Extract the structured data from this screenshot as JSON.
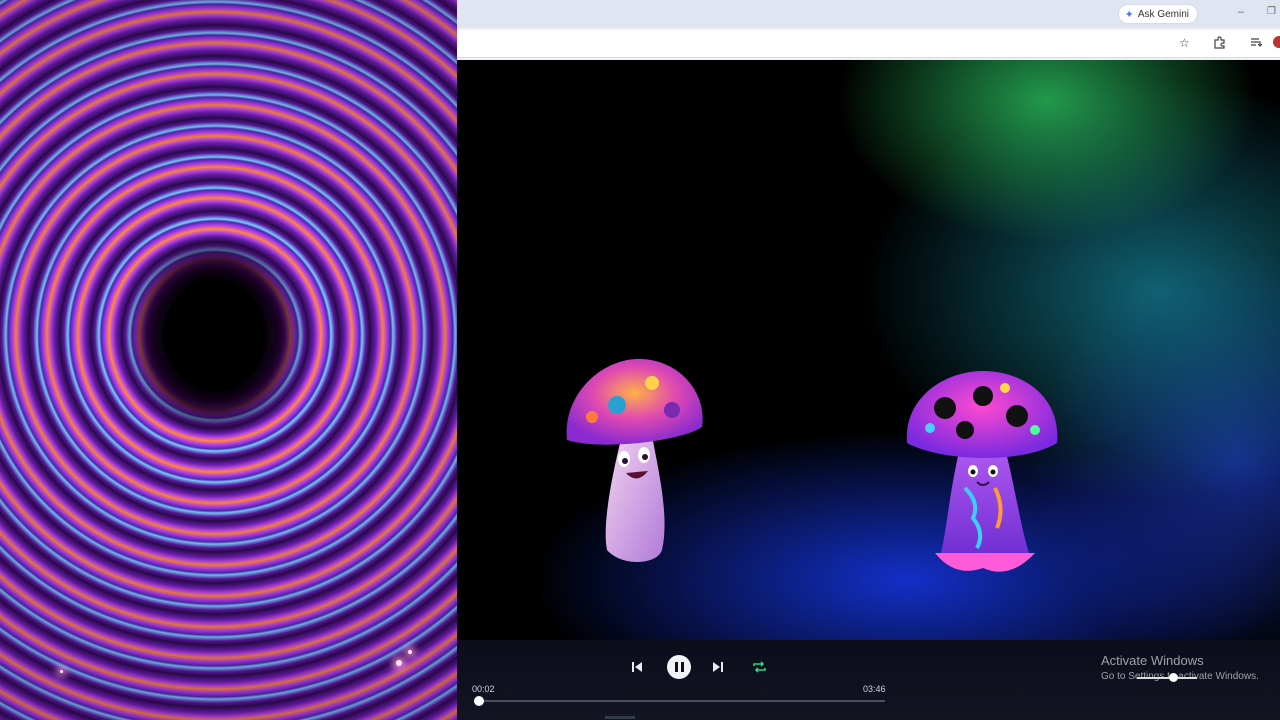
{
  "browser": {
    "gemini_label": "Ask Gemini"
  },
  "player": {
    "current_time": "00:02",
    "duration": "03:46",
    "progress": 0.009,
    "volume": 0.55,
    "state": "playing"
  },
  "watermark": {
    "line1": "Activate Windows",
    "line2": "Go to Settings to activate Windows."
  },
  "icons": {
    "previous": "skip-previous-icon",
    "pause": "pause-icon",
    "next": "skip-next-icon",
    "repeat": "repeat-icon",
    "bookmark": "star-icon",
    "extensions": "puzzle-icon",
    "reading_list": "reading-list-icon"
  },
  "colors": {
    "repeat_active": "#2fd27a",
    "control_bar": "#0f1220",
    "spiral_accent": "#c04ae0"
  }
}
